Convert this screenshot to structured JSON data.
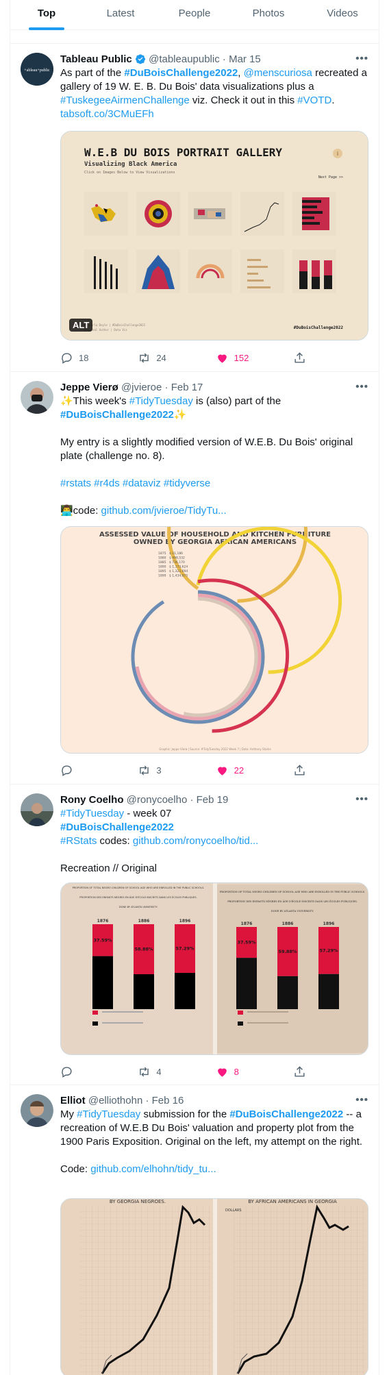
{
  "tabs": [
    {
      "label": "Top",
      "active": true
    },
    {
      "label": "Latest"
    },
    {
      "label": "People"
    },
    {
      "label": "Photos"
    },
    {
      "label": "Videos"
    }
  ],
  "tweets": [
    {
      "name": "Tableau Public",
      "handle": "@tableaupublic",
      "date": "Mar 15",
      "text_parts": [
        "As part of the ",
        "#DuBoisChallenge2022",
        ", ",
        "@menscuriosa",
        " recreated a gallery of 19 W. E. B. Du Bois' data visualizations plus a ",
        "#TuskegeeAirmenChallenge",
        " viz. Check it out in this ",
        "#VOTD",
        ". ",
        "tabsoft.co/3CMuEFh"
      ],
      "image": {
        "title": "W.E.B DU BOIS PORTRAIT GALLERY",
        "subtitle": "Visualizing Black America",
        "hint": "Click on Images Below to View Visualizations",
        "next": "Next Page >>",
        "credit1": "By Carla Doyle | #DuBoisChallenge2022",
        "credit2": "Original Author | Data Viz",
        "tag": "#DuBoisChallenge2022",
        "alt": "ALT"
      },
      "replies": "18",
      "retweets": "24",
      "likes": "152"
    },
    {
      "name": "Jeppe Vierø",
      "handle": "@jvieroe",
      "date": "Feb 17",
      "line1_parts": [
        "✨This week's ",
        "#TidyTuesday",
        " is (also) part of the"
      ],
      "line2_parts": [
        "#DuBoisChallenge2022",
        "✨"
      ],
      "para2": "My entry is a slightly modified version of W.E.B. Du Bois' original plate (challenge no. 8).",
      "hashtags": "#rstats #r4ds #dataviz #tidyverse",
      "code_label": "👨‍💻code: ",
      "code_link": "github.com/jvieroe/TidyTu...",
      "image": {
        "title": "ASSESSED VALUE OF HOUSEHOLD AND KITCHEN FURNITURE",
        "title2": "OWNED BY GEORGIA AFRICAN AMERICANS",
        "legend": [
          {
            "year": "1875",
            "value": "$ 21,186",
            "color": "#d7c7b9"
          },
          {
            "year": "1880",
            "value": "$ 498,532",
            "color": "#e9a4b0"
          },
          {
            "year": "1885",
            "value": "$ 736,170",
            "color": "#6c8cb4"
          },
          {
            "year": "1890",
            "value": "$ 1,173,624",
            "color": "#e8b84a"
          },
          {
            "year": "1895",
            "value": "$ 1,322,694",
            "color": "#f2d335"
          },
          {
            "year": "1899",
            "value": "$ 1,434,975",
            "color": "#d5334f"
          }
        ],
        "footer": "Graphic: Jeppe Vierø | Source: #TidyTuesday 2022 Week 7 | Data: Anthony Starks"
      },
      "replies": "",
      "retweets": "3",
      "likes": "22"
    },
    {
      "name": "Rony Coelho",
      "handle": "@ronycoelho",
      "date": "Feb 19",
      "line1_parts": [
        "#TidyTuesday",
        " - week 07"
      ],
      "line2": "#DuBoisChallenge2022",
      "line3_parts": [
        "#RStats",
        " codes: ",
        "github.com/ronycoelho/tid..."
      ],
      "para2": "Recreation // Original",
      "image": {
        "left_title": "PROPORTION OF TOTAL NEGRO CHILDREN OF SCHOOL AGE WHO ARE ENROLLED IN THE PUBLIC SCHOOLS.",
        "left_title2": "PROPORTION DES ENFANTS NÈGRES EN ÂGE D'ÉCOLE INSCRITS DANS LES ÉCOLES PUBLIQUES.",
        "left_sub": "DONE BY ATLANTA UNIVERSITY.",
        "right_title": "PROPORTION OF TOTAL NEGRO CHILDREN OF SCHOOL AGE WHO ARE ENROLLED IN THE PUBLIC SCHOOLS.",
        "right_title2": "PROPORTION DES ENFANTS NÈGRES EN ÂGE D'ÉCOLE INSCRITS DANS LES ÉCOLES PUBLIQUES.",
        "right_sub": "DONE BY ATLANTA UNIVERSITY.",
        "bars": [
          {
            "year": "1876",
            "pct": "37.59%",
            "value": 37.59
          },
          {
            "year": "1886",
            "pct": "58.88%",
            "value": 58.88
          },
          {
            "year": "1896",
            "pct": "57.29%",
            "value": 57.29
          }
        ],
        "bars_right": [
          {
            "year": "1876",
            "pct": "37.59%"
          },
          {
            "year": "1886",
            "pct": "59.88%"
          },
          {
            "year": "1896",
            "pct": "57.29%"
          }
        ]
      },
      "replies": "",
      "retweets": "4",
      "likes": "8"
    },
    {
      "name": "Elliot",
      "handle": "@elliothohn",
      "date": "Feb 16",
      "text_parts": [
        "My ",
        "#TidyTuesday",
        " submission for the ",
        "#DuBoisChallenge2022",
        " -- a recreation of W.E.B Du Bois' valuation and property plot from the 1900 Paris Exposition. Original on the left, my attempt on the right."
      ],
      "code_label": "Code: ",
      "code_link": "github.com/elhohn/tidy_tu...",
      "image": {
        "left_title": "BY GEORGIA NEGROES.",
        "right_title": "BY AFRICAN AMERICANS IN GEORGIA",
        "right_ylabel": "DOLLARS"
      }
    }
  ],
  "icons": {
    "reply": "reply-icon",
    "retweet": "retweet-icon",
    "like": "heart-icon",
    "share": "share-icon",
    "more": "more-icon",
    "verified": "verified-badge-icon"
  },
  "colors": {
    "accent": "#1d9bf0",
    "like": "#f91880",
    "text": "#0f1419",
    "muted": "#536471"
  }
}
